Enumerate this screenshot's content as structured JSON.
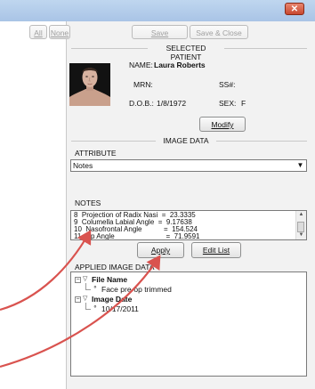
{
  "window": {
    "close_icon": "close-icon"
  },
  "toolbar": {
    "all_label": "All",
    "none_label": "None",
    "save_label": "Save",
    "save_close_label": "Save & Close"
  },
  "patient": {
    "section_title": "SELECTED PATIENT",
    "name_label": "NAME:",
    "name_value": "Laura Roberts",
    "mrn_label": "MRN:",
    "mrn_value": "",
    "ss_label": "SS#:",
    "ss_value": "",
    "dob_label": "D.O.B.:",
    "dob_value": "1/8/1972",
    "sex_label": "SEX:",
    "sex_value": "F",
    "modify_label": "Modify"
  },
  "image_data": {
    "section_title": "IMAGE DATA",
    "attribute_label": "ATTRIBUTE",
    "attribute_value": "Notes",
    "notes_label": "NOTES",
    "notes_lines": [
      "8  Projection of Radix Nasi  =  23.3335",
      "9  Columella Labial Angle  =  9.17638",
      "10  Nasofrontal Angle           =  154.524",
      "11  Tip Angle                          =  71.9591"
    ],
    "apply_label": "Apply",
    "edit_list_label": "Edit List"
  },
  "applied": {
    "section_title": "APPLIED IMAGE DATA",
    "tree": [
      {
        "label": "File Name",
        "child": "Face pre-op trimmed"
      },
      {
        "label": "Image Date",
        "child": "10/17/2011"
      }
    ]
  },
  "colors": {
    "annotation_arrow": "#d9534f",
    "titlebar": "#a9c4e6"
  }
}
